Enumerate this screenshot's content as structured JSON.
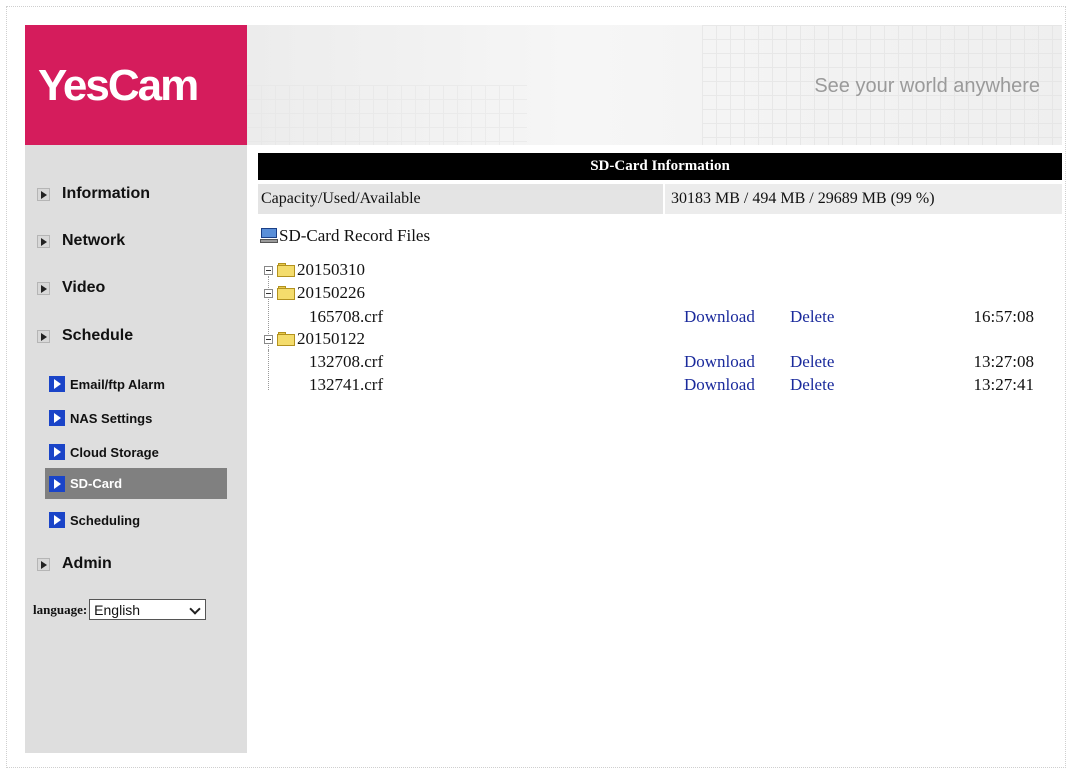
{
  "header": {
    "logo_text": "YesCam",
    "tagline": "See your world anywhere",
    "brand_color": "#d51c5c"
  },
  "sidebar": {
    "main_items": [
      {
        "label": "Information",
        "icon": "arrow-right-icon"
      },
      {
        "label": "Network",
        "icon": "arrow-right-icon"
      },
      {
        "label": "Video",
        "icon": "arrow-right-icon"
      },
      {
        "label": "Schedule",
        "icon": "arrow-right-icon"
      },
      {
        "label": "Admin",
        "icon": "arrow-right-icon"
      }
    ],
    "sub_items": [
      {
        "label": "Email/ftp Alarm"
      },
      {
        "label": "NAS Settings"
      },
      {
        "label": "Cloud Storage"
      },
      {
        "label": "SD-Card",
        "active": true
      },
      {
        "label": "Scheduling"
      }
    ],
    "language_label": "language:",
    "language_value": "English"
  },
  "main": {
    "title": "SD-Card Information",
    "capacity_label": "Capacity/Used/Available",
    "capacity_value": "30183 MB / 494 MB / 29689 MB (99 %)",
    "record_title": "SD-Card Record Files",
    "folders": [
      {
        "name": "20150310",
        "files": []
      },
      {
        "name": "20150226",
        "files": [
          {
            "name": "165708.crf",
            "download": "Download",
            "delete": "Delete",
            "time": "16:57:08"
          }
        ]
      },
      {
        "name": "20150122",
        "files": [
          {
            "name": "132708.crf",
            "download": "Download",
            "delete": "Delete",
            "time": "13:27:08"
          },
          {
            "name": "132741.crf",
            "download": "Download",
            "delete": "Delete",
            "time": "13:27:41"
          }
        ]
      }
    ]
  }
}
